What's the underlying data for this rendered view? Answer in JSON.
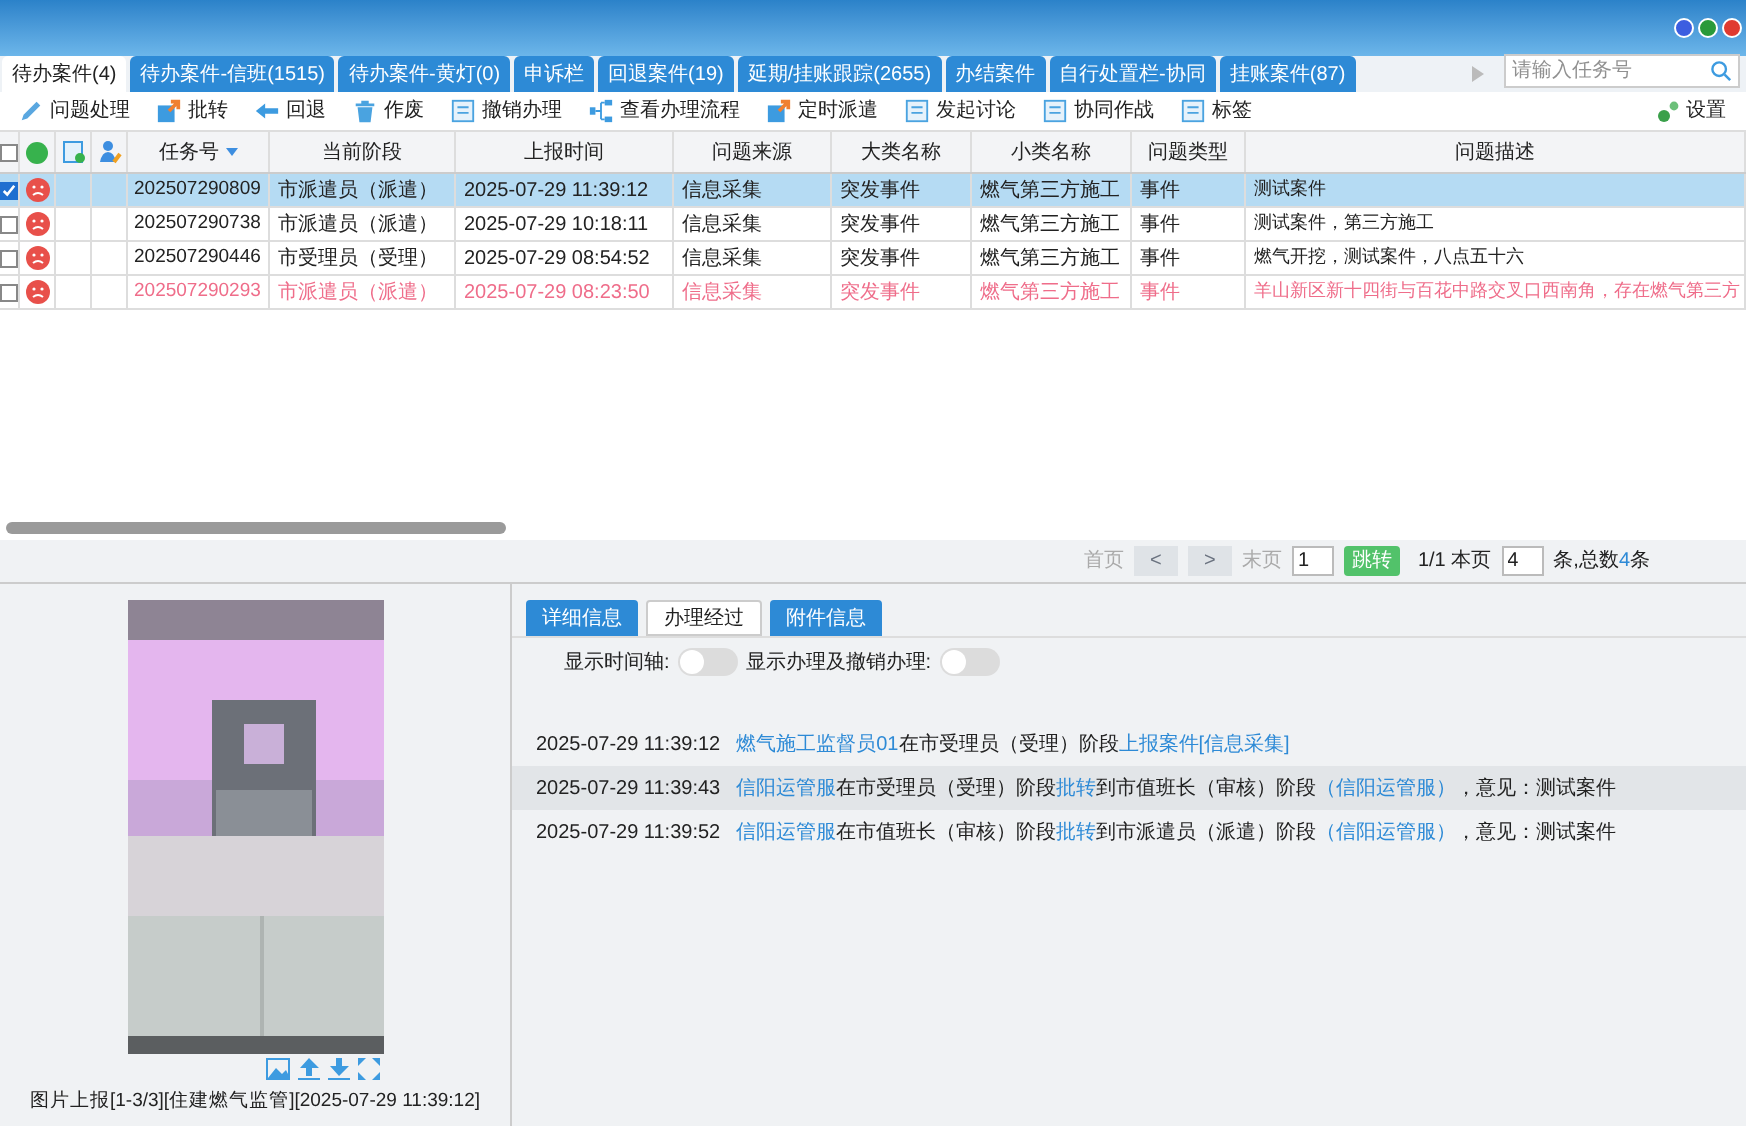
{
  "tabs": [
    {
      "label": "待办案件(4)",
      "selected": true
    },
    {
      "label": "待办案件-信班(1515)",
      "selected": false
    },
    {
      "label": "待办案件-黄灯(0)",
      "selected": false
    },
    {
      "label": "申诉栏",
      "selected": false
    },
    {
      "label": "回退案件(19)",
      "selected": false
    },
    {
      "label": "延期/挂账跟踪(2655)",
      "selected": false
    },
    {
      "label": "办结案件",
      "selected": false
    },
    {
      "label": "自行处置栏-协同",
      "selected": false
    },
    {
      "label": "挂账案件(87)",
      "selected": false
    }
  ],
  "search": {
    "placeholder": "请输入任务号"
  },
  "toolbar": [
    {
      "label": "问题处理",
      "kind": "pencil"
    },
    {
      "label": "批转",
      "kind": "forward"
    },
    {
      "label": "回退",
      "kind": "back"
    },
    {
      "label": "作废",
      "kind": "trash"
    },
    {
      "label": "撤销办理",
      "kind": "form"
    },
    {
      "label": "查看办理流程",
      "kind": "flow"
    },
    {
      "label": "定时派遣",
      "kind": "forward"
    },
    {
      "label": "发起讨论",
      "kind": "form"
    },
    {
      "label": "协同作战",
      "kind": "form"
    },
    {
      "label": "标签",
      "kind": "form"
    }
  ],
  "settings": {
    "label": "设置"
  },
  "table": {
    "header_checked": false,
    "columns": [
      "任务号",
      "当前阶段",
      "上报时间",
      "问题来源",
      "大类名称",
      "小类名称",
      "问题类型",
      "问题描述"
    ],
    "rows": [
      {
        "selected": true,
        "checked": true,
        "overdue": false,
        "cells": [
          "202507290809",
          "市派遣员（派遣）",
          "2025-07-29 11:39:12",
          "信息采集",
          "突发事件",
          "燃气第三方施工",
          "事件",
          "测试案件"
        ]
      },
      {
        "selected": false,
        "checked": false,
        "overdue": false,
        "cells": [
          "202507290738",
          "市派遣员（派遣）",
          "2025-07-29 10:18:11",
          "信息采集",
          "突发事件",
          "燃气第三方施工",
          "事件",
          "测试案件，第三方施工"
        ]
      },
      {
        "selected": false,
        "checked": false,
        "overdue": false,
        "cells": [
          "202507290446",
          "市受理员（受理）",
          "2025-07-29 08:54:52",
          "信息采集",
          "突发事件",
          "燃气第三方施工",
          "事件",
          "燃气开挖，测试案件，八点五十六"
        ]
      },
      {
        "selected": false,
        "checked": false,
        "overdue": true,
        "cells": [
          "202507290293",
          "市派遣员（派遣）",
          "2025-07-29 08:23:50",
          "信息采集",
          "突发事件",
          "燃气第三方施工",
          "事件",
          "羊山新区新十四街与百花中路交叉口西南角，存在燃气第三方"
        ]
      }
    ]
  },
  "pagination": {
    "first": "首页",
    "prev": "<",
    "next": ">",
    "last": "末页",
    "page": "1",
    "jump": "跳转",
    "pages": "1/1 本页",
    "page_size": "4",
    "total_label": "条,总数",
    "total": "4",
    "unit": "条"
  },
  "photo": {
    "caption": "图片上报[1-3/3][住建燃气监管][2025-07-29 11:39:12]"
  },
  "detail_tabs": [
    {
      "label": "详细信息",
      "selected": false
    },
    {
      "label": "办理经过",
      "selected": true
    },
    {
      "label": "附件信息",
      "selected": false
    }
  ],
  "toggles": [
    {
      "label": "显示时间轴:",
      "on": false
    },
    {
      "label": "显示办理及撤销办理:",
      "on": false
    }
  ],
  "log": [
    {
      "time": "2025-07-29 11:39:12",
      "highlighted": false,
      "parts": [
        {
          "text": "燃气施工监督员01",
          "link": true
        },
        {
          "text": "在市受理员（受理）阶段",
          "link": false
        },
        {
          "text": "上报案件[信息采集]",
          "link": true
        }
      ]
    },
    {
      "time": "2025-07-29 11:39:43",
      "highlighted": true,
      "parts": [
        {
          "text": "信阳运管服",
          "link": true
        },
        {
          "text": "在市受理员（受理）阶段",
          "link": false
        },
        {
          "text": "批转",
          "link": true
        },
        {
          "text": "到市值班长（审核）阶段",
          "link": false
        },
        {
          "text": "（信阳运管服）",
          "link": true
        },
        {
          "text": "，意见：测试案件",
          "link": false
        }
      ]
    },
    {
      "time": "2025-07-29 11:39:52",
      "highlighted": false,
      "parts": [
        {
          "text": "信阳运管服",
          "link": true
        },
        {
          "text": "在市值班长（审核）阶段",
          "link": false
        },
        {
          "text": "批转",
          "link": true
        },
        {
          "text": "到市派遣员（派遣）阶段",
          "link": false
        },
        {
          "text": "（信阳运管服）",
          "link": true
        },
        {
          "text": "，意见：测试案件",
          "link": false
        }
      ]
    }
  ]
}
